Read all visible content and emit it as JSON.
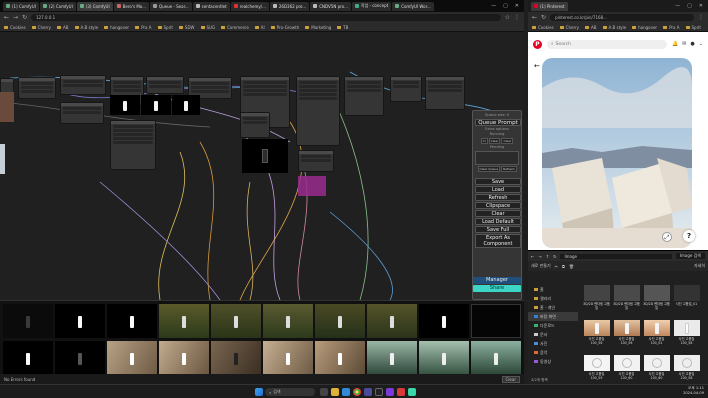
{
  "left_browser": {
    "tabs": [
      "(1) ComfyUI",
      "(2) ComfyUI",
      "(3) ComfyUI",
      "Bero's Mo...",
      "Queue - Sear...",
      "sentacentlet",
      "realchemy/...",
      "26D362 pro...",
      "CNDV5N pro...",
      "작업 - concept",
      "ComfyUI Wor..."
    ],
    "url": "127.0.0.1",
    "bookmarks": [
      "Cookies",
      "Cherry",
      "AB",
      "A.B style",
      "hangover",
      "Pra A",
      "Sprit",
      "SDW",
      "SUG",
      "Commerce",
      "AI",
      "Pro-Growth",
      "Marketing",
      "TB"
    ]
  },
  "queue_panel": {
    "queue_size": "Queue size: 0",
    "queue_prompt": "Queue Prompt",
    "extra_options": "Extra options",
    "running": "Running",
    "pending": "Pending",
    "clear_queue": "Clear Queue",
    "refresh": "Refresh",
    "mini_buttons": [
      "Cl",
      "Clear",
      "Clear"
    ],
    "save": "Save",
    "load": "Load",
    "refresh_btn": "Refresh",
    "clipspace": "Clipspace",
    "clear": "Clear",
    "load_default": "Load Default",
    "save_full": "Save Full",
    "export_as_component": "Export As Component",
    "manager": "Manager",
    "share": "Share"
  },
  "statusbar": {
    "left": "No Errors found",
    "clear": "Clear"
  },
  "right_browser": {
    "tabs": [
      "(1) Pinterest"
    ],
    "url": "pinterest.co.kr/pin/7168...",
    "bookmarks": [
      "Cookies",
      "Cherry",
      "AB",
      "A.B style",
      "hangover",
      "Pra A",
      "Sprit"
    ],
    "search_placeholder": "Search",
    "help": "?"
  },
  "explorer": {
    "breadcrumb": [
      "Image"
    ],
    "search_placeholder": "Image 검색",
    "new_label": "새로 만들기",
    "view_label": "자세히",
    "sidebar": [
      "홈",
      "갤러리",
      "홈 - 개인",
      "바탕 화면",
      "다운로드",
      "문서",
      "사진",
      "음악",
      "동영상"
    ],
    "items": [
      "3D/2D 렌더링 고품질",
      "3D/2D 렌더링 고품질",
      "3D/2D 렌더링 고품질",
      "사진 고품질_01",
      "사진 고품질 100_56",
      "사진 고품질 100_56",
      "사진 고품질 100_02",
      "사진 고품질 100_58",
      "사진 고품질 100_59",
      "사진 고품질 100_60",
      "사진 고품질 100_60",
      "사진 고품질 100_58"
    ],
    "footer": "3/2개 항목"
  },
  "taskbar": {
    "search": "검색",
    "time": "오후 1:11",
    "date": "2024-04-09"
  },
  "colors": {
    "manager": "#1f4f7a",
    "share": "#3dd6c6",
    "pinterest": "#e60023"
  }
}
